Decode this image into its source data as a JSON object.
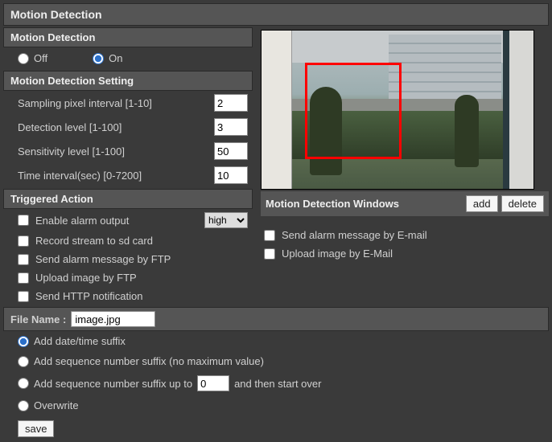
{
  "title": "Motion Detection",
  "motion": {
    "header": "Motion Detection",
    "off_label": "Off",
    "on_label": "On",
    "selected": "on"
  },
  "settings": {
    "header": "Motion Detection Setting",
    "sampling_label": "Sampling pixel interval [1-10]",
    "sampling_value": "2",
    "detection_label": "Detection level [1-100]",
    "detection_value": "3",
    "sensitivity_label": "Sensitivity level [1-100]",
    "sensitivity_value": "50",
    "time_label": "Time interval(sec) [0-7200]",
    "time_value": "10"
  },
  "triggered": {
    "header": "Triggered Action",
    "enable_alarm": "Enable alarm output",
    "alarm_level": "high",
    "record_sd": "Record stream to sd card",
    "send_ftp_msg": "Send alarm message by FTP",
    "upload_ftp": "Upload image by FTP",
    "send_http": "Send HTTP notification",
    "send_email_msg": "Send alarm message by E-mail",
    "upload_email": "Upload image by E-Mail"
  },
  "preview": {
    "label": "Motion Detection Windows",
    "add": "add",
    "delete": "delete"
  },
  "filename": {
    "label": "File Name :",
    "value": "image.jpg",
    "add_date": "Add date/time suffix",
    "add_seq": "Add sequence number suffix (no maximum value)",
    "add_seq_upto_a": "Add sequence number suffix up to",
    "add_seq_upto_val": "0",
    "add_seq_upto_b": "and then start over",
    "overwrite": "Overwrite",
    "selected": "date"
  },
  "save": "save"
}
